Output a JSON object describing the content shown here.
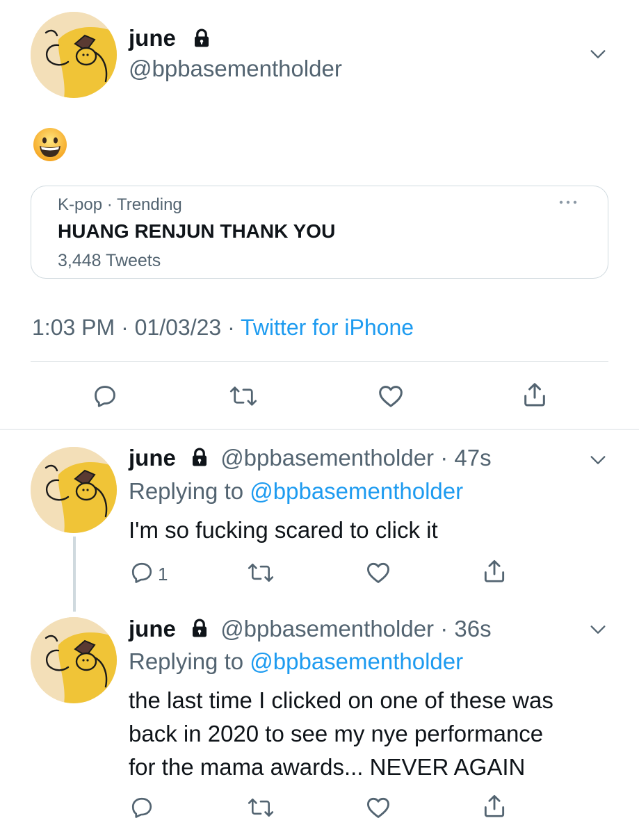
{
  "main_tweet": {
    "user_name": "june",
    "handle": "@bpbasementholder",
    "protected_icon": "lock-icon",
    "emoji": "grinning-face-emoji",
    "card": {
      "context": "K-pop · Trending",
      "title": "HUANG RENJUN THANK YOU",
      "count": "3,448 Tweets",
      "more_icon": "more-dots-icon"
    },
    "time": "1:03 PM · 01/03/23 · ",
    "source": "Twitter for iPhone",
    "actions": [
      "reply-icon",
      "retweet-icon",
      "like-icon",
      "share-icon"
    ]
  },
  "replies": [
    {
      "user_name": "june",
      "handle": "@bpbasementholder",
      "time": "· 47s",
      "replying_prefix": "Replying to ",
      "replying_handle": "@bpbasementholder",
      "text_lines": [
        "I'm so fucking scared to click it"
      ],
      "reply_count": "1"
    },
    {
      "user_name": "june",
      "handle": "@bpbasementholder",
      "time": "· 36s",
      "replying_prefix": "Replying to ",
      "replying_handle": "@bpbasementholder",
      "text_lines": [
        "the last time I clicked on one of these was",
        "back in 2020 to see my nye performance",
        "for the mama awards... NEVER AGAIN"
      ],
      "reply_count": ""
    }
  ],
  "colors": {
    "text": "#0f1419",
    "secondary": "#536471",
    "link": "#1d9bf0",
    "avatar_bg": "#f3dfb8",
    "avatar_yellow": "#f0c437"
  }
}
